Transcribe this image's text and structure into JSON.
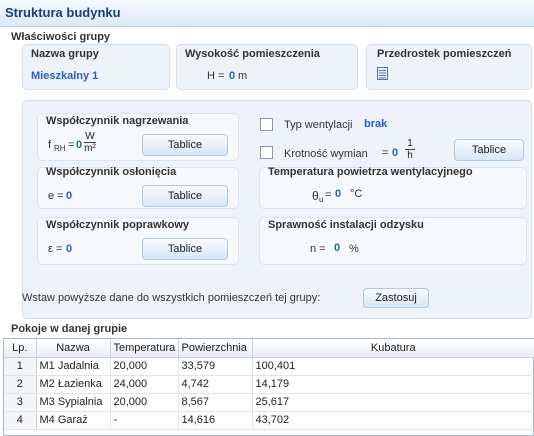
{
  "window": {
    "title": "Struktura budynku"
  },
  "properties": {
    "section_title": "Właściwości grupy",
    "group_name": {
      "label": "Nazwa grupy",
      "value": "Mieszkalny 1"
    },
    "room_height": {
      "label": "Wysokość pomieszczenia",
      "symbol": "H =",
      "value": "0",
      "unit": "m"
    },
    "room_prefix": {
      "label": "Przedrostek pomieszczeń",
      "icon": "list-icon"
    },
    "heating_coeff": {
      "label": "Współczynnik nagrzewania",
      "symbol": "f",
      "subscript": "RH",
      "eq": "=",
      "value": "0",
      "unit_num": "W",
      "unit_den": "m²",
      "button": "Tablice"
    },
    "ventilation_type": {
      "label": "Typ wentylacji",
      "value": "brak",
      "checked": false
    },
    "exchange_rate": {
      "label": "Krotność wymian",
      "eq": "=",
      "value": "0",
      "unit_num": "1",
      "unit_den": "h",
      "checked": false,
      "button": "Tablice"
    },
    "shielding_coeff": {
      "label": "Współczynnik osłonięcia",
      "symbol": "e =",
      "value": "0",
      "button": "Tablice"
    },
    "vent_air_temp": {
      "label": "Temperatura powietrza wentylacyjnego",
      "symbol": "θ",
      "subscript": "u",
      "eq": "=",
      "value": "0",
      "unit": "°C"
    },
    "correction_coeff": {
      "label": "Współczynnik poprawkowy",
      "symbol": "ε =",
      "value": "0",
      "button": "Tablice"
    },
    "recovery_efficiency": {
      "label": "Sprawność instalacji odzysku",
      "symbol": "n =",
      "value": "0",
      "unit": "%"
    },
    "apply": {
      "text": "Wstaw powyższe dane do wszystkich pomieszczeń tej grupy:",
      "button": "Zastosuj"
    }
  },
  "rooms": {
    "section_title": "Pokoje w danej grupie",
    "columns": [
      "Lp.",
      "Nazwa",
      "Temperatura",
      "Powierzchnia",
      "Kubatura"
    ],
    "rows": [
      [
        "1",
        "M1 Jadalnia",
        "20,000",
        "33,579",
        "100,401"
      ],
      [
        "2",
        "M2 Łazienka",
        "24,000",
        "4,742",
        "14,179"
      ],
      [
        "3",
        "M3 Sypialnia",
        "20,000",
        "8,567",
        "25,617"
      ],
      [
        "4",
        "M4 Garaż",
        "-",
        "14,616",
        "43,702"
      ]
    ]
  }
}
